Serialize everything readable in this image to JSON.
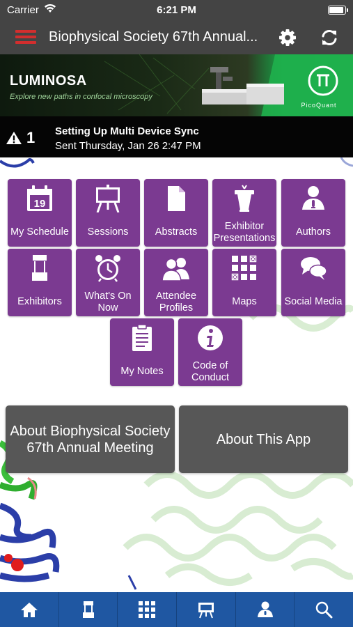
{
  "status_bar": {
    "carrier": "Carrier",
    "time": "6:21 PM"
  },
  "nav": {
    "title": "Biophysical Society 67th Annual..."
  },
  "banner": {
    "brand": "LUMINOSA",
    "tagline": "Explore new paths in confocal microscopy",
    "sponsor": "PicoQuant"
  },
  "alert": {
    "count": "1",
    "headline": "Setting Up Multi Device Sync",
    "sent": "Sent Thursday, Jan 26 2:47 PM"
  },
  "tiles": [
    {
      "label": "My Schedule",
      "icon": "calendar-icon",
      "calendar_day": "19"
    },
    {
      "label": "Sessions",
      "icon": "easel-icon"
    },
    {
      "label": "Abstracts",
      "icon": "document-icon"
    },
    {
      "label": "Exhibitor Presentations",
      "icon": "podium-icon"
    },
    {
      "label": "Authors",
      "icon": "speaker-icon"
    },
    {
      "label": "Exhibitors",
      "icon": "booth-icon"
    },
    {
      "label": "What's On Now",
      "icon": "alarm-clock-icon"
    },
    {
      "label": "Attendee Profiles",
      "icon": "people-icon"
    },
    {
      "label": "Maps",
      "icon": "map-grid-icon"
    },
    {
      "label": "Social Media",
      "icon": "chat-bubbles-icon"
    },
    {
      "label": "My Notes",
      "icon": "clipboard-icon"
    },
    {
      "label": "Code of Conduct",
      "icon": "info-icon"
    }
  ],
  "buttons": {
    "about_meeting": "About Biophysical Society 67th Annual Meeting",
    "about_app": "About This App"
  },
  "tabbar": [
    "home-icon",
    "booth-icon",
    "map-grid-icon",
    "easel-icon",
    "speaker-icon",
    "search-icon"
  ],
  "colors": {
    "tile": "#7b3a91",
    "bar": "#444444",
    "tabbar": "#1f57a2",
    "menu": "#d22e2e"
  }
}
